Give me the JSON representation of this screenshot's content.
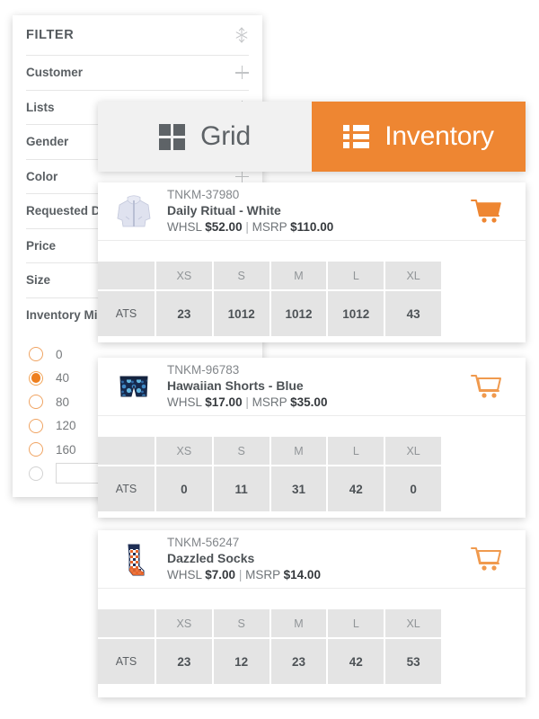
{
  "filter": {
    "title": "FILTER",
    "collapse_icon": "collapse-arrows-icon",
    "rows": [
      {
        "label": "Customer",
        "icon": "plus-icon"
      },
      {
        "label": "Lists",
        "icon": "plus-icon"
      },
      {
        "label": "Gender",
        "icon": "plus-icon"
      },
      {
        "label": "Color",
        "icon": "plus-icon"
      },
      {
        "label": "Requested Date",
        "icon": "plus-icon"
      },
      {
        "label": "Price",
        "icon": "plus-icon"
      },
      {
        "label": "Size",
        "icon": "plus-icon"
      },
      {
        "label": "Inventory Min",
        "icon": "plus-icon"
      }
    ],
    "inventory_min": {
      "options": [
        "0",
        "40",
        "80",
        "120",
        "160"
      ],
      "selected": "40",
      "custom_value": "",
      "custom_placeholder": ""
    }
  },
  "view_tabs": [
    {
      "label": "Grid",
      "icon": "grid-icon",
      "active": false
    },
    {
      "label": "Inventory",
      "icon": "list-icon",
      "active": true
    }
  ],
  "colors": {
    "accent_orange": "#ee8632",
    "radio_orange": "#ee7f1e",
    "tab_inactive_bg": "#f1f1f1",
    "table_cell_bg": "#e4e4e4",
    "text_dark": "#4d5256",
    "text_muted": "#82868a"
  },
  "size_columns": [
    "XS",
    "S",
    "M",
    "L",
    "XL"
  ],
  "row_label": "ATS",
  "products": [
    {
      "sku": "TNKM-37980",
      "name": "Daily Ritual - White",
      "whsl_label": "WHSL",
      "whsl_price": "$52.00",
      "separator": "|",
      "msrp_label": "MSRP",
      "msrp_price": "$110.00",
      "thumb": "white-hoodie-jacket",
      "cart_icon": "cart-filled-icon",
      "cart_state": "filled",
      "ats": [
        "23",
        "1012",
        "1012",
        "1012",
        "43"
      ]
    },
    {
      "sku": "TNKM-96783",
      "name": "Hawaiian Shorts - Blue",
      "whsl_label": "WHSL",
      "whsl_price": "$17.00",
      "separator": "|",
      "msrp_label": "MSRP",
      "msrp_price": "$35.00",
      "thumb": "blue-floral-shorts",
      "cart_icon": "cart-outline-icon",
      "cart_state": "outline",
      "ats": [
        "0",
        "11",
        "31",
        "42",
        "0"
      ]
    },
    {
      "sku": "TNKM-56247",
      "name": "Dazzled Socks",
      "whsl_label": "WHSL",
      "whsl_price": "$7.00",
      "separator": "|",
      "msrp_label": "MSRP",
      "msrp_price": "$14.00",
      "thumb": "patterned-socks",
      "cart_icon": "cart-outline-icon",
      "cart_state": "outline",
      "ats": [
        "23",
        "12",
        "23",
        "42",
        "53"
      ]
    }
  ]
}
